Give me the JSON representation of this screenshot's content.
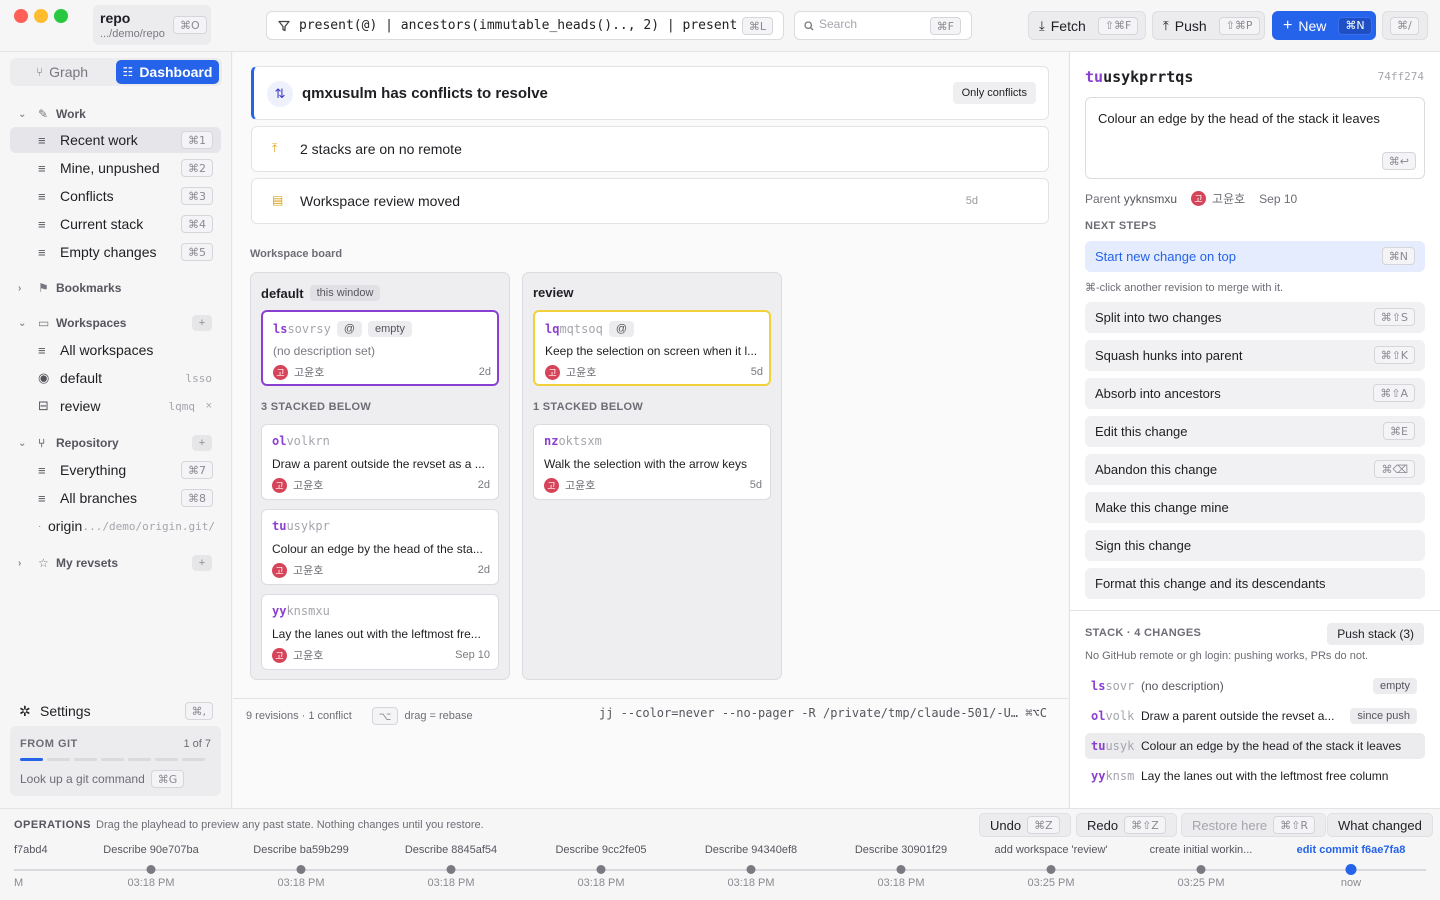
{
  "colors": {
    "accent": "#2563eb",
    "change_id": "#8b3fd1",
    "conflict": "#f0d13a",
    "avatar": "#d6445a"
  },
  "topbar": {
    "repo_name": "repo",
    "repo_path": ".../demo/repo",
    "repo_shortcut": "⌘O",
    "revset": "present(@) | ancestors(immutable_heads().., 2) | present(trunk())",
    "revset_shortcut": "⌘L",
    "search_placeholder": "Search",
    "search_shortcut": "⌘F",
    "fetch_label": "Fetch",
    "fetch_shortcut": "⇧⌘F",
    "push_label": "Push",
    "push_shortcut": "⇧⌘P",
    "new_label": "New",
    "new_shortcut": "⌘N",
    "help_shortcut": "⌘/"
  },
  "sidebar": {
    "graph_label": "Graph",
    "dashboard_label": "Dashboard",
    "work_section": "Work",
    "work_items": [
      {
        "label": "Recent work",
        "shortcut": "⌘1"
      },
      {
        "label": "Mine, unpushed",
        "shortcut": "⌘2"
      },
      {
        "label": "Conflicts",
        "shortcut": "⌘3"
      },
      {
        "label": "Current stack",
        "shortcut": "⌘4"
      },
      {
        "label": "Empty changes",
        "shortcut": "⌘5"
      }
    ],
    "bookmarks_section": "Bookmarks",
    "workspaces_section": "Workspaces",
    "workspaces_all": "All workspaces",
    "workspace_default": {
      "label": "default",
      "hint": "lsso"
    },
    "workspace_review": {
      "label": "review",
      "hint": "lqmq"
    },
    "repository_section": "Repository",
    "everything": {
      "label": "Everything",
      "shortcut": "⌘7"
    },
    "all_branches": {
      "label": "All branches",
      "shortcut": "⌘8"
    },
    "origin": {
      "label": "origin",
      "hint": ".../demo/origin.git/"
    },
    "revsets_section": "My revsets",
    "settings_label": "Settings",
    "settings_shortcut": "⌘,",
    "from_git_title": "FROM GIT",
    "from_git_count": "1 of 7",
    "from_git_progress": 1,
    "from_git_total": 7,
    "lookup_label": "Look up a git command",
    "lookup_shortcut": "⌘G"
  },
  "main": {
    "conflict_title": "qmxusulm has conflicts to resolve",
    "only_conflicts": "Only conflicts",
    "no_remote": "2 stacks are on no remote",
    "review_moved": "Workspace review moved",
    "review_age": "5d",
    "board_label": "Workspace board",
    "default_col": {
      "title": "default",
      "tag": "this window",
      "head": {
        "pre": "ls",
        "rest": "sovrsy",
        "at": "@",
        "chip": "empty",
        "desc": "(no description set)",
        "author": "고윤호",
        "age": "2d"
      },
      "stacked_label": "3 STACKED BELOW",
      "stack": [
        {
          "pre": "ol",
          "rest": "volkrn",
          "desc": "Draw a parent outside the revset as a ...",
          "author": "고윤호",
          "age": "2d"
        },
        {
          "pre": "tu",
          "rest": "usykpr",
          "desc": "Colour an edge by the head of the sta...",
          "author": "고윤호",
          "age": "2d"
        },
        {
          "pre": "yy",
          "rest": "knsmxu",
          "desc": "Lay the lanes out with the leftmost fre...",
          "author": "고윤호",
          "age": "Sep 10"
        }
      ]
    },
    "review_col": {
      "title": "review",
      "head": {
        "pre": "lq",
        "rest": "mqtsoq",
        "at": "@",
        "desc": "Keep the selection on screen when it l...",
        "author": "고윤호",
        "age": "5d"
      },
      "stacked_label": "1 STACKED BELOW",
      "stack": [
        {
          "pre": "nz",
          "rest": "oktsxm",
          "desc": "Walk the selection with the arrow keys",
          "author": "고윤호",
          "age": "5d"
        }
      ]
    },
    "footer_status": "9 revisions · 1 conflict",
    "drag_key": "⌥",
    "drag_hint": "drag = rebase",
    "command": "jj --color=never --no-pager -R /private/tmp/claude-501/-U… ⌘⌥C"
  },
  "detail": {
    "id_pre": "tu",
    "id_rest": "usykprrtqs",
    "hash": "74ff274",
    "description": "Colour an edge by the head of the stack it leaves",
    "desc_shortcut": "⌘↩",
    "parent_label": "Parent",
    "parent_id": "yyknsmxu",
    "author": "고윤호",
    "date": "Sep 10",
    "next_steps": "NEXT STEPS",
    "start_new": {
      "label": "Start new change on top",
      "shortcut": "⌘N"
    },
    "merge_hint": "⌘-click another revision to merge with it.",
    "actions": [
      {
        "label": "Split into two changes",
        "shortcut": "⌘⇧S"
      },
      {
        "label": "Squash hunks into parent",
        "shortcut": "⌘⇧K"
      },
      {
        "label": "Absorb into ancestors",
        "shortcut": "⌘⇧A"
      },
      {
        "label": "Edit this change",
        "shortcut": "⌘E"
      },
      {
        "label": "Abandon this change",
        "shortcut": "⌘⌫"
      },
      {
        "label": "Make this change mine",
        "shortcut": ""
      },
      {
        "label": "Sign this change",
        "shortcut": ""
      },
      {
        "label": "Format this change and its descendants",
        "shortcut": ""
      }
    ],
    "stack_head": "STACK · 4 CHANGES",
    "push_stack": "Push stack (3)",
    "stack_note": "No GitHub remote or gh login: pushing works, PRs do not.",
    "stack": [
      {
        "pre": "ls",
        "rest": "sovr",
        "text": "(no description)",
        "chip": "empty"
      },
      {
        "pre": "ol",
        "rest": "volk",
        "text": "Draw a parent outside the revset a...",
        "chip": "since push"
      },
      {
        "pre": "tu",
        "rest": "usyk",
        "text": "Colour an edge by the head of the stack it leaves",
        "chip": ""
      },
      {
        "pre": "yy",
        "rest": "knsm",
        "text": "Lay the lanes out with the leftmost free column",
        "chip": ""
      }
    ]
  },
  "ops": {
    "title": "OPERATIONS",
    "hint": "Drag the playhead to preview any past state. Nothing changes until you restore.",
    "undo": "Undo",
    "undo_shortcut": "⌘Z",
    "redo": "Redo",
    "redo_shortcut": "⌘⇧Z",
    "restore": "Restore here",
    "restore_shortcut": "⌘⇧R",
    "what_changed": "What changed",
    "timeline": [
      {
        "label": "f7abd4",
        "time": "M"
      },
      {
        "label": "Describe 90e707ba",
        "time": "03:18 PM"
      },
      {
        "label": "Describe ba59b299",
        "time": "03:18 PM"
      },
      {
        "label": "Describe 8845af54",
        "time": "03:18 PM"
      },
      {
        "label": "Describe 9cc2fe05",
        "time": "03:18 PM"
      },
      {
        "label": "Describe 94340ef8",
        "time": "03:18 PM"
      },
      {
        "label": "Describe 30901f29",
        "time": "03:18 PM"
      },
      {
        "label": "add workspace 'review'",
        "time": "03:25 PM"
      },
      {
        "label": "create initial workin...",
        "time": "03:25 PM"
      },
      {
        "label": "edit commit f6ae7fa8",
        "time": "now"
      }
    ]
  }
}
